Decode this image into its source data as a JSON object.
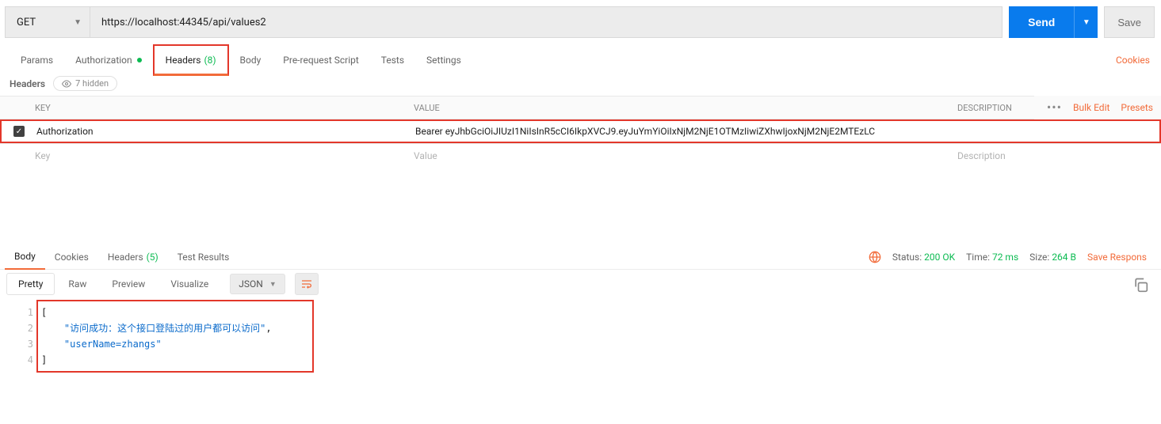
{
  "request": {
    "method": "GET",
    "url": "https://localhost:44345/api/values2",
    "send_label": "Send",
    "save_label": "Save"
  },
  "req_tabs": {
    "params": "Params",
    "authorization": "Authorization",
    "headers": "Headers",
    "headers_count": "(8)",
    "body": "Body",
    "pre": "Pre-request Script",
    "tests": "Tests",
    "settings": "Settings",
    "cookies": "Cookies"
  },
  "headers_sub": {
    "label": "Headers",
    "hidden_label": "7 hidden"
  },
  "headers_table": {
    "col_key": "KEY",
    "col_value": "VALUE",
    "col_desc": "DESCRIPTION",
    "bulk_edit": "Bulk Edit",
    "presets": "Presets",
    "row": {
      "key": "Authorization",
      "value": "Bearer eyJhbGciOiJIUzI1NiIsInR5cCI6IkpXVCJ9.eyJuYmYiOiIxNjM2NjE1OTMzIiwiZXhwIjoxNjM2NjE2MTEzLC"
    },
    "placeholders": {
      "key": "Key",
      "value": "Value",
      "desc": "Description"
    }
  },
  "resp_tabs": {
    "body": "Body",
    "cookies": "Cookies",
    "headers": "Headers",
    "headers_count": "(5)",
    "tests": "Test Results"
  },
  "resp_meta": {
    "status_label": "Status:",
    "status_value": "200 OK",
    "time_label": "Time:",
    "time_value": "72 ms",
    "size_label": "Size:",
    "size_value": "264 B",
    "save_response": "Save Respons"
  },
  "resp_toolbar": {
    "pretty": "Pretty",
    "raw": "Raw",
    "preview": "Preview",
    "visualize": "Visualize",
    "lang": "JSON"
  },
  "response_body": {
    "lines": [
      "[",
      "    \"访问成功：这个接口登陆过的用户都可以访问\"",
      "    \"userName=zhangs\"",
      "]"
    ],
    "line1": "[",
    "line2_str": "\"访问成功：这个接口登陆过的用户都可以访问\"",
    "line2_comma": ",",
    "line3_str": "\"userName=zhangs\"",
    "line4": "]"
  }
}
